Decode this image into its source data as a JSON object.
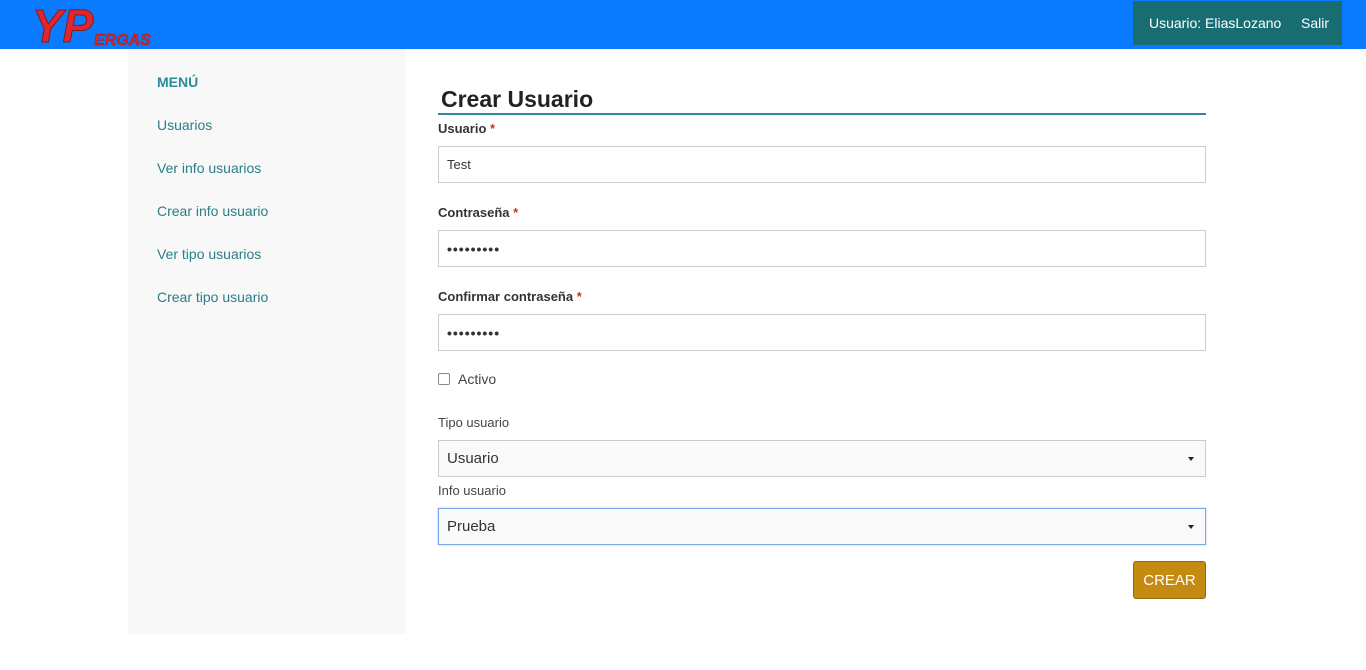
{
  "header": {
    "logo_text": "YPERGAS",
    "user_label": "Usuario: EliasLozano",
    "logout_label": "Salir"
  },
  "sidebar": {
    "title": "MENÚ",
    "items": [
      {
        "label": "Usuarios"
      },
      {
        "label": "Ver info usuarios"
      },
      {
        "label": "Crear info usuario"
      },
      {
        "label": "Ver tipo usuarios"
      },
      {
        "label": "Crear tipo usuario"
      }
    ]
  },
  "form": {
    "title": "Crear Usuario",
    "required_mark": "*",
    "usuario": {
      "label": "Usuario",
      "value": "Test"
    },
    "contrasena": {
      "label": "Contraseña",
      "value": "•••••••••"
    },
    "confirmar": {
      "label": "Confirmar contraseña",
      "value": "•••••••••"
    },
    "activo": {
      "label": "Activo",
      "checked": false
    },
    "tipo_usuario": {
      "label": "Tipo usuario",
      "selected": "Usuario"
    },
    "info_usuario": {
      "label": "Info usuario",
      "selected": "Prueba"
    },
    "submit_label": "CREAR"
  },
  "colors": {
    "topbar": "#0a7afe",
    "user_box": "#176d72",
    "accent": "#2a8c96",
    "button": "#c58a12",
    "logo_red": "#e0262f"
  }
}
